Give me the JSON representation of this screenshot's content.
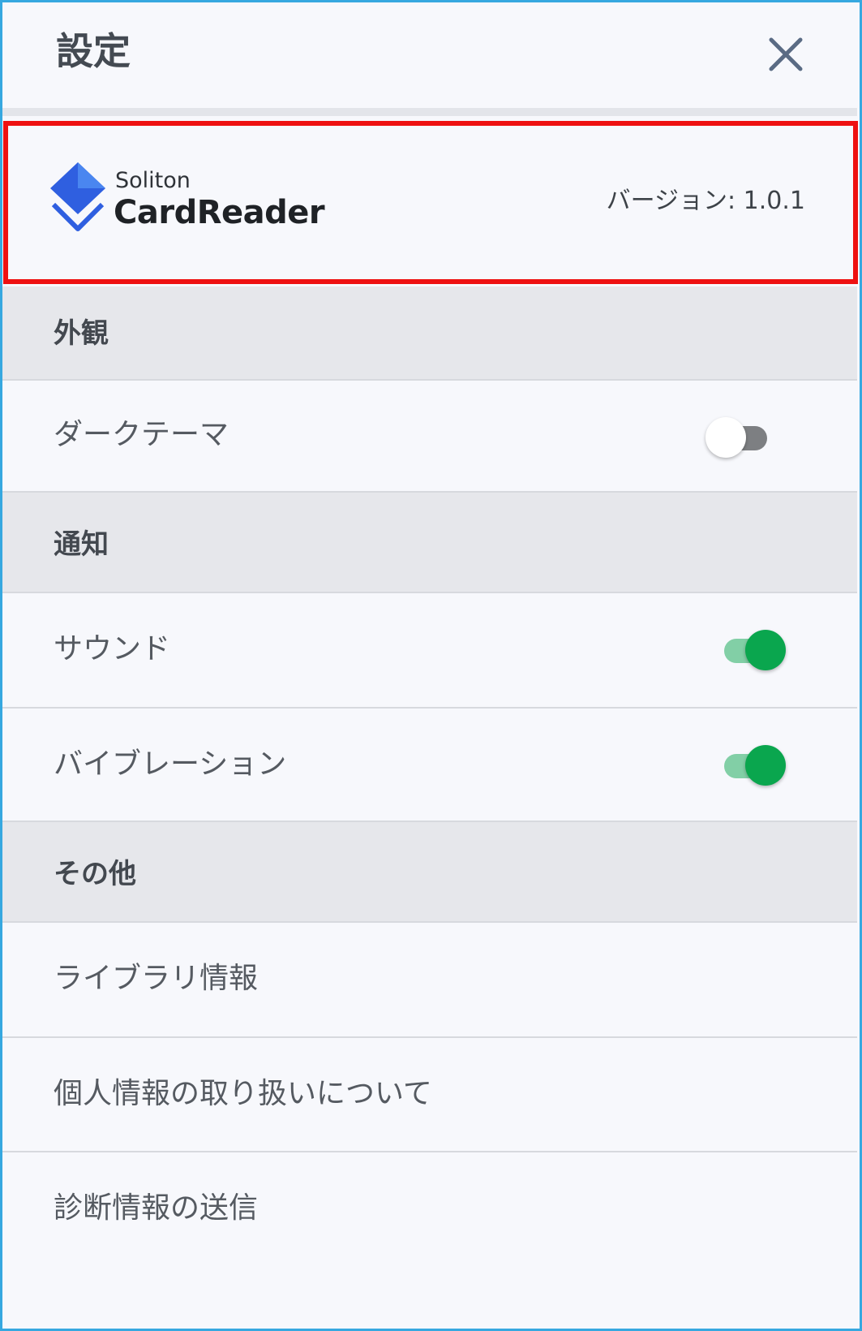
{
  "header": {
    "title": "設定",
    "close_icon": "close-icon"
  },
  "about": {
    "logo_icon": "soliton-cardreader-logo",
    "brand_small": "Soliton",
    "brand_large": "CardReader",
    "version": "バージョン: 1.0.1",
    "highlight_color": "#ee1111"
  },
  "sections": {
    "appearance": {
      "label": "外観",
      "dark_theme": {
        "label": "ダークテーマ",
        "enabled": false
      }
    },
    "notifications": {
      "label": "通知",
      "sound": {
        "label": "サウンド",
        "enabled": true
      },
      "vibration": {
        "label": "バイブレーション",
        "enabled": true
      }
    },
    "other": {
      "label": "その他",
      "items": [
        {
          "label": "ライブラリ情報"
        },
        {
          "label": "個人情報の取り扱いについて"
        },
        {
          "label": "診断情報の送信"
        }
      ]
    }
  },
  "colors": {
    "toggle_on": "#0aa64e",
    "toggle_on_track": "#82cfa6",
    "toggle_off_track": "#7d7f82",
    "frame_border": "#36a8e0",
    "logo_blue": "#2f5fe0"
  }
}
